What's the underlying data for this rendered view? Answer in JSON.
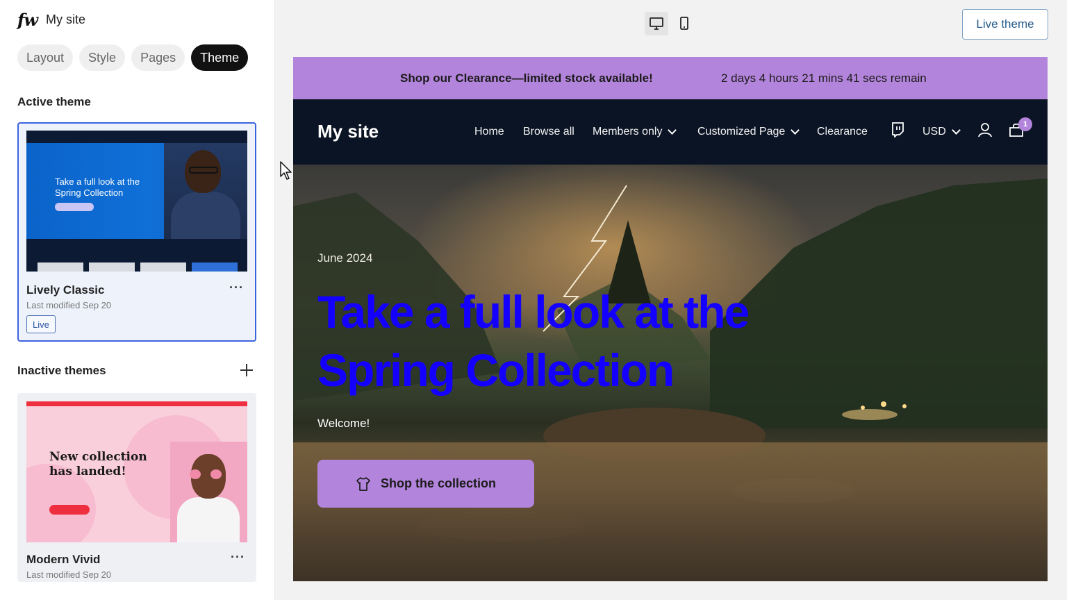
{
  "brand": {
    "logo": "fw",
    "site_name": "My site"
  },
  "tabs": [
    {
      "label": "Layout",
      "active": false
    },
    {
      "label": "Style",
      "active": false
    },
    {
      "label": "Pages",
      "active": false
    },
    {
      "label": "Theme",
      "active": true
    }
  ],
  "active_theme": {
    "section_title": "Active theme",
    "name": "Lively Classic",
    "modified": "Last modified Sep 20",
    "badge": "Live",
    "more": "···",
    "thumb_text": "Take a full look at the Spring Collection"
  },
  "inactive_themes": {
    "section_title": "Inactive themes",
    "items": [
      {
        "name": "Modern Vivid",
        "modified": "Last modified Sep 20",
        "more": "···",
        "thumb_text": "New collection has landed!"
      }
    ]
  },
  "topbar": {
    "live_theme_label": "Live theme"
  },
  "preview": {
    "announcement": {
      "message": "Shop our Clearance—limited stock available!",
      "timer": "2 days 4 hours 21 mins 41 secs remain"
    },
    "nav": {
      "site_title": "My site",
      "links": [
        "Home",
        "Browse all",
        "Members only",
        "Customized Page",
        "Clearance"
      ],
      "currency": "USD",
      "cart_count": "1"
    },
    "hero": {
      "date": "June 2024",
      "title": "Take a full look at the Spring Collection",
      "welcome": "Welcome!",
      "cta": "Shop the collection"
    }
  },
  "colors": {
    "accent_purple": "#b384db",
    "nav_bg": "#0b1424",
    "hero_title": "#1400ff",
    "active_border": "#3b63e0"
  }
}
